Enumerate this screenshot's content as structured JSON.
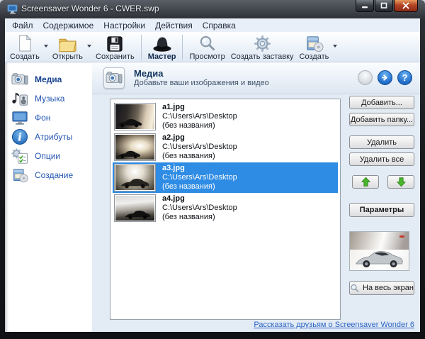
{
  "window": {
    "title": "Screensaver Wonder 6 - CWER.swp"
  },
  "menu": {
    "items": [
      {
        "label": "Файл"
      },
      {
        "label": "Содержимое"
      },
      {
        "label": "Настройки"
      },
      {
        "label": "Действия"
      },
      {
        "label": "Справка"
      }
    ]
  },
  "toolbar": {
    "buttons": [
      {
        "label": "Создать",
        "icon": "new-document-icon",
        "has_dropdown": true
      },
      {
        "label": "Открыть",
        "icon": "open-folder-icon",
        "has_dropdown": true
      },
      {
        "label": "Сохранить",
        "icon": "save-floppy-icon",
        "has_dropdown": false
      },
      {
        "label": "Мастер",
        "icon": "wizard-hat-icon",
        "has_dropdown": false
      },
      {
        "label": "Просмотр",
        "icon": "preview-magnifier-icon",
        "has_dropdown": false
      },
      {
        "label": "Создать заставку",
        "icon": "build-gear-icon",
        "has_dropdown": false
      },
      {
        "label": "Создать",
        "icon": "package-box-icon",
        "has_dropdown": true
      }
    ]
  },
  "sidebar": {
    "items": [
      {
        "label": "Медиа",
        "icon": "camera-icon",
        "selected": true
      },
      {
        "label": "Музыка",
        "icon": "music-icon",
        "selected": false
      },
      {
        "label": "Фон",
        "icon": "monitor-icon",
        "selected": false
      },
      {
        "label": "Атрибуты",
        "icon": "info-icon",
        "selected": false
      },
      {
        "label": "Опции",
        "icon": "options-icon",
        "selected": false
      },
      {
        "label": "Создание",
        "icon": "package-box-icon",
        "selected": false
      }
    ]
  },
  "main": {
    "header": {
      "title": "Медиа",
      "subtitle": "Добавьте ваши изображения и видео",
      "icon": "camera-icon",
      "nav": [
        "back-circle-button",
        "forward-circle-button",
        "help-circle-button"
      ]
    },
    "media_list": [
      {
        "name": "a1.jpg",
        "path": "C:\\Users\\Ars\\Desktop",
        "caption": "(без названия)",
        "selected": false
      },
      {
        "name": "a2.jpg",
        "path": "C:\\Users\\Ars\\Desktop",
        "caption": "(без названия)",
        "selected": false
      },
      {
        "name": "a3.jpg",
        "path": "C:\\Users\\Ars\\Desktop",
        "caption": "(без названия)",
        "selected": true
      },
      {
        "name": "a4.jpg",
        "path": "C:\\Users\\Ars\\Desktop",
        "caption": "(без названия)",
        "selected": false
      }
    ],
    "buttons": {
      "add": "Добавить...",
      "add_folder": "Добавить папку...",
      "remove": "Удалить",
      "remove_all": "Удалить все",
      "move_up_icon": "green-arrow-up-icon",
      "move_down_icon": "green-arrow-down-icon",
      "parameters": "Параметры",
      "fullscreen": "На весь экран"
    },
    "footer_link": "Рассказать друзьям о Screensaver Wonder 6"
  },
  "colors": {
    "selection_blue": "#2f8ce4",
    "link_blue": "#2a64c5",
    "sidebar_text_blue": "#2355b4",
    "header_title_blue": "#12365e",
    "arrow_green": "#47b02b",
    "close_button_red": "#b34425"
  }
}
